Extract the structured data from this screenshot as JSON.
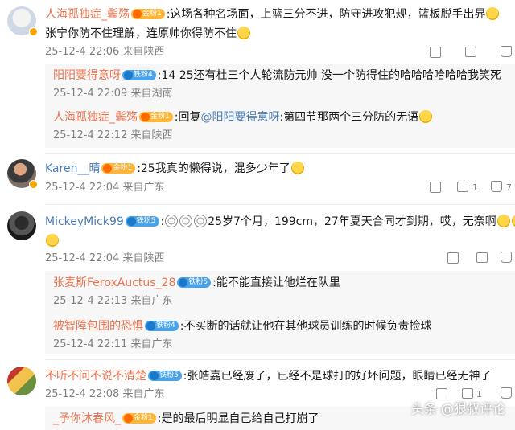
{
  "comments": [
    {
      "user": "人海孤独症_鬓殇",
      "badge": "金粉1",
      "text": ":这场各种名场面，上篮三分不进，防守进攻犯规，篮板脱手出界",
      "text2": "张宁你防不住理解，连原帅你得防不住",
      "time": "25-12-4 22:06 来自陕西",
      "replies": [
        {
          "user": "阳阳要得意呀",
          "badge": "铁粉4",
          "text": ":14 25还有杜三个人轮流防元帅 没一个防得住的哈哈哈哈哈哈我笑死",
          "time": "25-12-4 22:09 来自湖南"
        },
        {
          "user": "人海孤独症_鬓殇",
          "badge": "金粉1",
          "prefix": ":回复",
          "mention": "@阳阳要得意呀",
          "text": ":第四节那两个三分防的无语",
          "time": "25-12-4 22:12 来自陕西"
        }
      ]
    },
    {
      "user": "Karen__晴",
      "badge": "金粉1",
      "text": ":25我真的懒得说，混多少年了",
      "time": "25-12-4 22:04 来自广东",
      "comment_count": "1",
      "like_count": "7"
    },
    {
      "user": "MickeyMick99",
      "badge": "铁粉5",
      "text": "25岁7个月，199cm，27年夏天合同才到期，哎，无奈啊",
      "time": "25-12-4 22:04 来自陕西",
      "replies": [
        {
          "user": "张麦斯FeroxAuctus_28",
          "badge": "铁粉5",
          "text": ":能不能直接让他烂在队里",
          "time": "25-12-4 22:13 来自广东"
        },
        {
          "user": "被智障包围的恐惧",
          "badge": "铁粉4",
          "text": ":不买断的话就让他在其他球员训练的时候负责捡球",
          "time": "25-12-4 22:11 来自广东"
        }
      ]
    },
    {
      "user": "不听不问不说不清楚",
      "badge": "铁粉5",
      "text": ":张皓嘉已经废了，已经不是球打的好坏问题，眼睛已经无神了",
      "time": "25-12-4 22:08 来自广东",
      "comment_count": "1",
      "replies": [
        {
          "user": "_予你沐春风_",
          "badge": "金粉1",
          "text": ":是的最后明显自己给自己打崩了"
        }
      ]
    }
  ],
  "watermark": "头条 @狠叔评论",
  "colors": {
    "username": "#eb7350",
    "mention": "#4a7bb7",
    "meta": "#808080",
    "reply_bg": "#f7f7f7"
  }
}
